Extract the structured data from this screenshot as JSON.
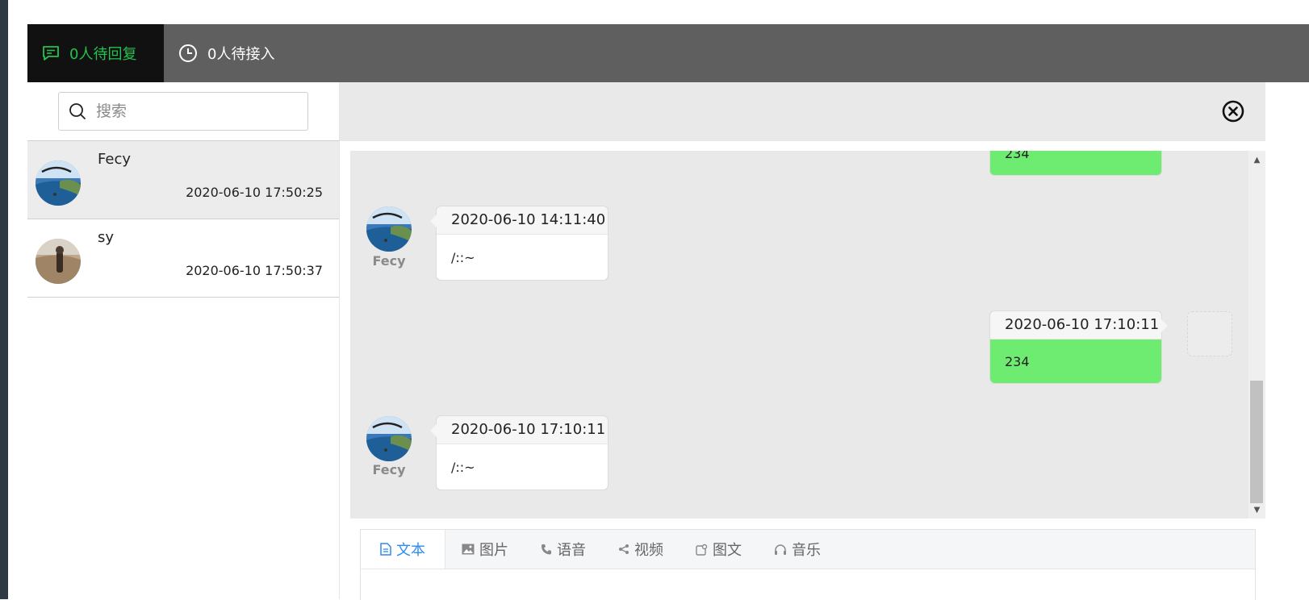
{
  "header": {
    "tab_replies": "0人待回复",
    "tab_waiting": "0人待接入"
  },
  "search": {
    "placeholder": "搜索"
  },
  "contacts": [
    {
      "name": "Fecy",
      "time": "2020-06-10 17:50:25"
    },
    {
      "name": "sy",
      "time": "2020-06-10 17:50:37"
    }
  ],
  "messages": {
    "partial_text": "234",
    "items": [
      {
        "sender": "Fecy",
        "time": "2020-06-10 14:11:40",
        "text": "/::~"
      },
      {
        "sender": "",
        "time": "2020-06-10 17:10:11",
        "text": "234"
      },
      {
        "sender": "Fecy",
        "time": "2020-06-10 17:10:11",
        "text": "/::~"
      }
    ]
  },
  "composer": {
    "tabs": [
      "文本",
      "图片",
      "语音",
      "视频",
      "图文",
      "音乐"
    ]
  },
  "colors": {
    "accent_green": "#22c34e",
    "sent_bubble": "#6eec72",
    "active_tab_blue": "#2d8cf0",
    "topbar": "#5f5f5f"
  },
  "icons": [
    "message-icon",
    "clock-icon",
    "search-icon",
    "close-circle-icon",
    "document-icon",
    "image-icon",
    "phone-icon",
    "share-icon",
    "article-icon",
    "headphones-icon"
  ]
}
